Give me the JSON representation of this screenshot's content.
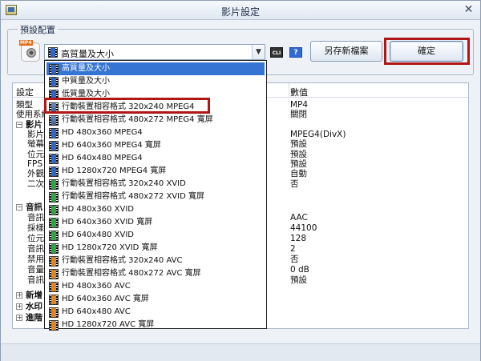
{
  "window": {
    "title": "影片設定"
  },
  "preset": {
    "group_label": "預設配置",
    "icon_tag": "MP4",
    "selected_value": "高質量及大小",
    "cli_icon": "CLI",
    "help_icon": "?",
    "save_new_label": "另存新檔案",
    "ok_label": "確定"
  },
  "table": {
    "headers": [
      "設定",
      "數值"
    ],
    "rows": [
      {
        "setting": "類型",
        "value": "MP4"
      },
      {
        "setting": "使用系統",
        "value": "關閉"
      },
      {
        "setting": "影片",
        "value": "",
        "group": true
      },
      {
        "setting": "影片",
        "value": "MPEG4(DivX)"
      },
      {
        "setting": "螢幕",
        "value": "預設"
      },
      {
        "setting": "位元",
        "value": "預設"
      },
      {
        "setting": "FPS",
        "value": "預設"
      },
      {
        "setting": "外觀",
        "value": "自動"
      },
      {
        "setting": "二次",
        "value": "否"
      },
      {
        "setting": "音訊",
        "value": "",
        "group": true
      },
      {
        "setting": "音訊",
        "value": "AAC"
      },
      {
        "setting": "採樣",
        "value": "44100"
      },
      {
        "setting": "位元",
        "value": "128"
      },
      {
        "setting": "音訊",
        "value": "2"
      },
      {
        "setting": "禁用",
        "value": "否"
      },
      {
        "setting": "音量",
        "value": "0 dB"
      },
      {
        "setting": "音訊",
        "value": "預設"
      },
      {
        "setting": "新增",
        "value": "",
        "group": true,
        "collapsed": true
      },
      {
        "setting": "水印",
        "value": "",
        "group": true,
        "collapsed": true
      },
      {
        "setting": "進階",
        "value": "",
        "group": true,
        "collapsed": true
      }
    ]
  },
  "dropdown": {
    "items": [
      {
        "label": "高質量及大小",
        "icon": "blue",
        "selected": true
      },
      {
        "label": "中質量及大小",
        "icon": "blue"
      },
      {
        "label": "低質量及大小",
        "icon": "blue"
      },
      {
        "label": "行動裝置相容格式 320x240 MPEG4",
        "icon": "mpeg4"
      },
      {
        "label": "行動裝置相容格式 480x272 MPEG4 寬屏",
        "icon": "mpeg4"
      },
      {
        "label": "HD 480x360 MPEG4",
        "icon": "blue"
      },
      {
        "label": "HD 640x360 MPEG4 寬屏",
        "icon": "blue"
      },
      {
        "label": "HD 640x480 MPEG4",
        "icon": "blue"
      },
      {
        "label": "HD 1280x720 MPEG4 寬屏",
        "icon": "blue"
      },
      {
        "label": "行動裝置相容格式 320x240 XVID",
        "icon": "green"
      },
      {
        "label": "行動裝置相容格式 480x272 XVID 寬屏",
        "icon": "green"
      },
      {
        "label": "HD 480x360 XVID",
        "icon": "green"
      },
      {
        "label": "HD 640x360 XVID 寬屏",
        "icon": "green"
      },
      {
        "label": "HD 640x480 XVID",
        "icon": "green"
      },
      {
        "label": "HD 1280x720 XVID 寬屏",
        "icon": "green"
      },
      {
        "label": "行動裝置相容格式 320x240 AVC",
        "icon": "orange"
      },
      {
        "label": "行動裝置相容格式 480x272 AVC 寬屏",
        "icon": "orange"
      },
      {
        "label": "HD 480x360 AVC",
        "icon": "orange"
      },
      {
        "label": "HD 640x360 AVC 寬屏",
        "icon": "orange"
      },
      {
        "label": "HD 640x480 AVC",
        "icon": "orange"
      },
      {
        "label": "HD 1280x720 AVC 寬屏",
        "icon": "orange"
      }
    ]
  },
  "colors": {
    "selection": "#3574d2",
    "highlight_border": "#b01616"
  }
}
